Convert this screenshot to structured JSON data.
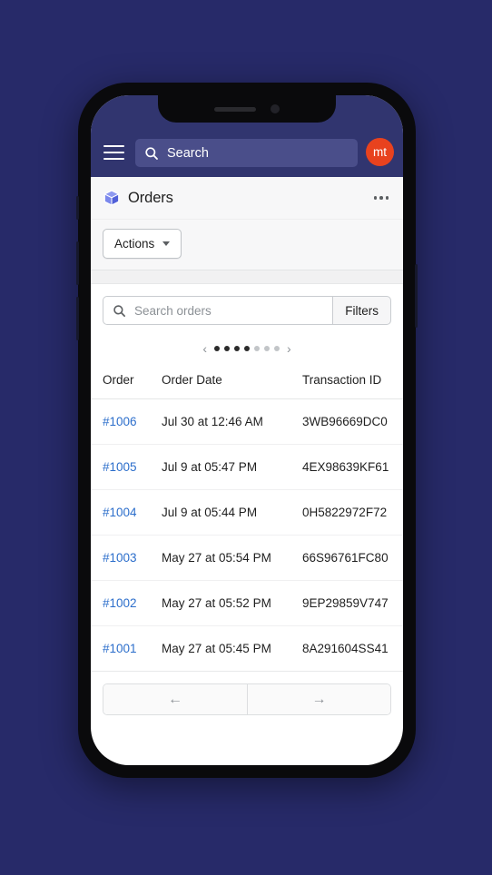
{
  "window": {
    "background_color": "#272a69",
    "device": "smartphone-mockup"
  },
  "topbar": {
    "background_color": "#31356f",
    "menu_icon": "hamburger-icon",
    "search": {
      "icon": "search-icon",
      "placeholder": "Search",
      "value": ""
    },
    "avatar": {
      "initials": "mt",
      "color": "#e8421e"
    }
  },
  "page_header": {
    "icon": "cube-icon",
    "title": "Orders",
    "more_menu": "…"
  },
  "actions_row": {
    "actions_label": "Actions",
    "caret_icon": "chevron-down-icon"
  },
  "filter_row": {
    "search_icon": "search-icon",
    "search_placeholder": "Search orders",
    "search_value": "",
    "filters_label": "Filters"
  },
  "dots_pager": {
    "prev_icon": "‹",
    "next_icon": "›",
    "total_dots": 7,
    "active_dots": 4
  },
  "table": {
    "columns": [
      "Order",
      "Order Date",
      "Transaction ID"
    ],
    "rows": [
      {
        "order": "#1006",
        "date": "Jul 30 at 12:46 AM",
        "transaction_id": "3WB96669DC0"
      },
      {
        "order": "#1005",
        "date": "Jul 9 at 05:47 PM",
        "transaction_id": "4EX98639KF61"
      },
      {
        "order": "#1004",
        "date": "Jul 9 at 05:44 PM",
        "transaction_id": "0H5822972F72"
      },
      {
        "order": "#1003",
        "date": "May 27 at 05:54 PM",
        "transaction_id": "66S96761FC80"
      },
      {
        "order": "#1002",
        "date": "May 27 at 05:52 PM",
        "transaction_id": "9EP29859V747"
      },
      {
        "order": "#1001",
        "date": "May 27 at 05:45 PM",
        "transaction_id": "8A291604SS41"
      }
    ]
  },
  "table_footer": {
    "prev_icon": "←",
    "next_icon": "→"
  }
}
